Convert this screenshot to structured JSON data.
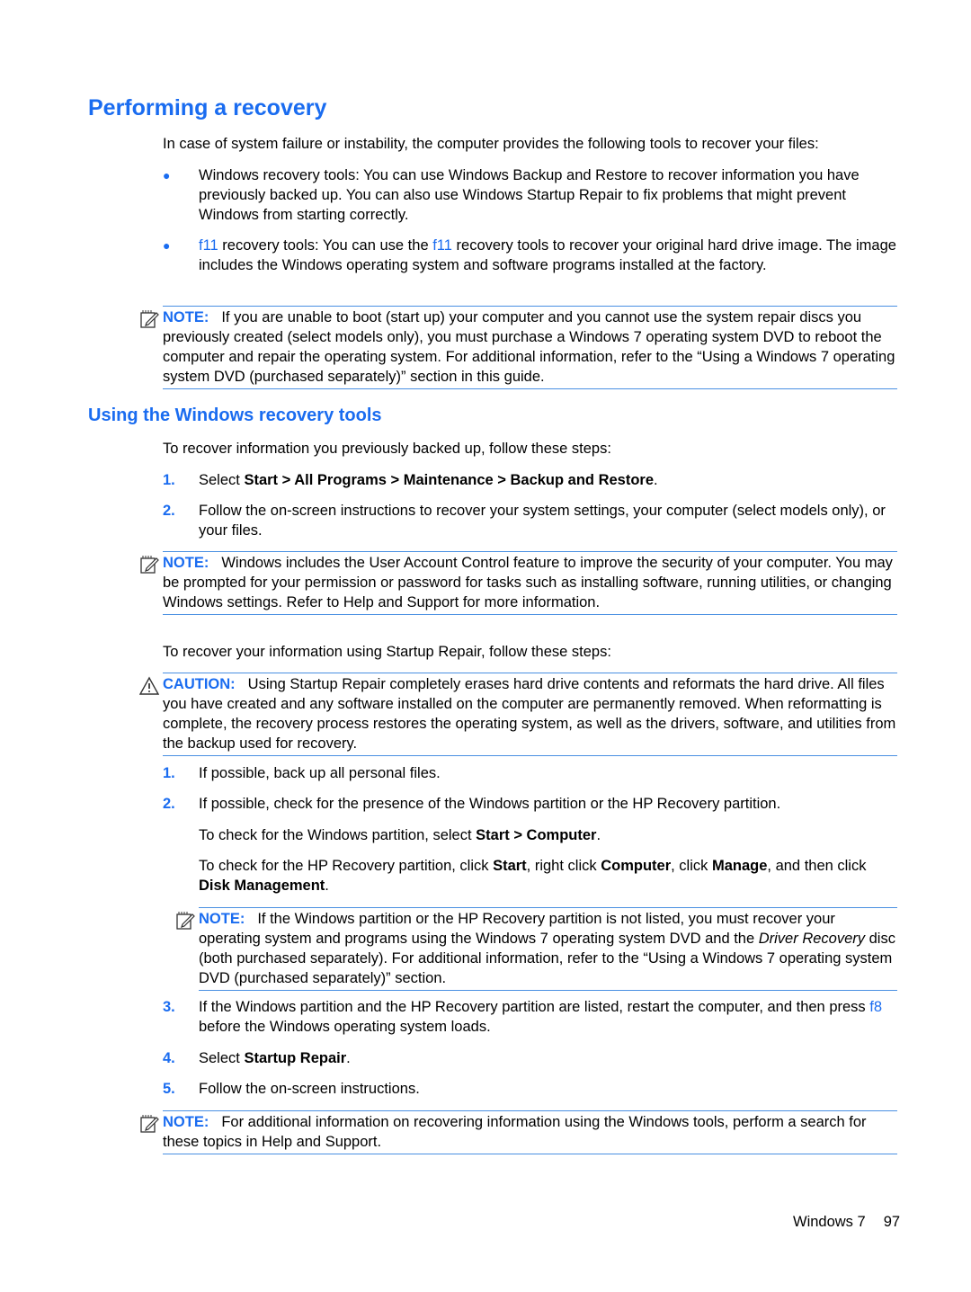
{
  "section": {
    "title": "Performing a recovery",
    "intro": "In case of system failure or instability, the computer provides the following tools to recover your files:",
    "bullets": [
      {
        "lead": "",
        "text": "Windows recovery tools: You can use Windows Backup and Restore to recover information you have previously backed up. You can also use Windows Startup Repair to fix problems that might prevent Windows from starting correctly."
      },
      {
        "lead": "f11",
        "text_a": " recovery tools: You can use the ",
        "key": "f11",
        "text_b": " recovery tools to recover your original hard drive image. The image includes the Windows operating system and software programs installed at the factory."
      }
    ],
    "note1": {
      "label": "NOTE:",
      "text": "If you are unable to boot (start up) your computer and you cannot use the system repair discs you previously created (select models only), you must purchase a Windows 7 operating system DVD to reboot the computer and repair the operating system. For additional information, refer to the “Using a Windows 7 operating system DVD (purchased separately)” section in this guide."
    }
  },
  "subsection": {
    "title": "Using the Windows recovery tools",
    "intro": "To recover information you previously backed up, follow these steps:",
    "steps_a": [
      {
        "num": "1.",
        "pre": "Select ",
        "bold": "Start > All Programs > Maintenance > Backup and Restore",
        "post": "."
      },
      {
        "num": "2.",
        "text": "Follow the on-screen instructions to recover your system settings, your computer (select models only), or your files."
      }
    ],
    "note2": {
      "label": "NOTE:",
      "text": "Windows includes the User Account Control feature to improve the security of your computer. You may be prompted for your permission or password for tasks such as installing software, running utilities, or changing Windows settings. Refer to Help and Support for more information."
    },
    "intro2": "To recover your information using Startup Repair, follow these steps:",
    "caution": {
      "label": "CAUTION:",
      "text": "Using Startup Repair completely erases hard drive contents and reformats the hard drive. All files you have created and any software installed on the computer are permanently removed. When reformatting is complete, the recovery process restores the operating system, as well as the drivers, software, and utilities from the backup used for recovery."
    },
    "steps_b": [
      {
        "num": "1.",
        "text": "If possible, back up all personal files."
      },
      {
        "num": "2.",
        "text": "If possible, check for the presence of the Windows partition or the HP Recovery partition."
      }
    ],
    "sub_windows": {
      "pre": "To check for the Windows partition, select ",
      "bold": "Start > Computer",
      "post": "."
    },
    "sub_hp": {
      "a": "To check for the HP Recovery partition, click ",
      "b1": "Start",
      "c": ", right click ",
      "b2": "Computer",
      "d": ", click ",
      "b3": "Manage",
      "e": ", and then click ",
      "b4": "Disk Management",
      "f": "."
    },
    "note3": {
      "label": "NOTE:",
      "text_a": "If the Windows partition or the HP Recovery partition is not listed, you must recover your operating system and programs using the Windows 7 operating system DVD and the ",
      "italic": "Driver Recovery",
      "text_b": " disc (both purchased separately). For additional information, refer to the “Using a Windows 7 operating system DVD (purchased separately)” section."
    },
    "step3": {
      "num": "3.",
      "a": "If the Windows partition and the HP Recovery partition are listed, restart the computer, and then press ",
      "key": "f8",
      "b": " before the Windows operating system loads."
    },
    "step4": {
      "num": "4.",
      "pre": "Select ",
      "bold": "Startup Repair",
      "post": "."
    },
    "step5": {
      "num": "5.",
      "text": "Follow the on-screen instructions."
    },
    "note4": {
      "label": "NOTE:",
      "text": "For additional information on recovering information using the Windows tools, perform a search for these topics in Help and Support."
    }
  },
  "footer": {
    "chapter": "Windows 7",
    "page": "97"
  }
}
